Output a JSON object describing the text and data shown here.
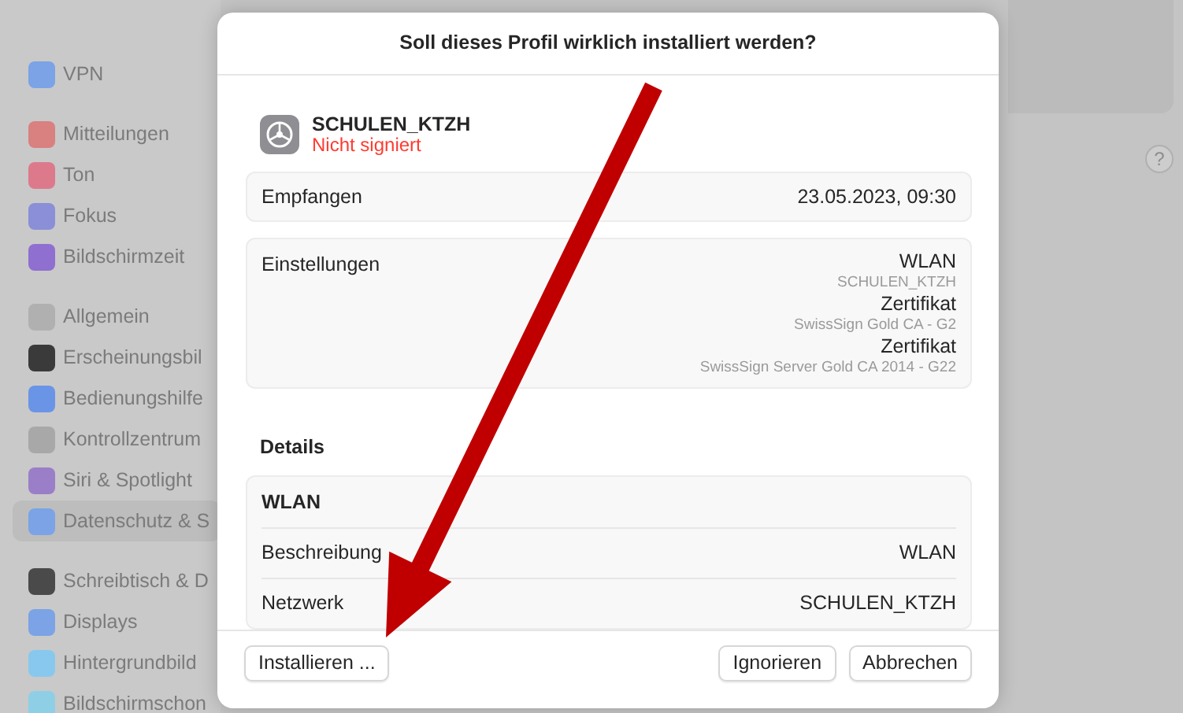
{
  "sidebar": {
    "groups": [
      {
        "items": [
          {
            "label": "VPN",
            "color": "#7ba3e6",
            "selected": false
          }
        ]
      },
      {
        "items": [
          {
            "label": "Mitteilungen",
            "color": "#d98080",
            "selected": false
          },
          {
            "label": "Ton",
            "color": "#dc7a8c",
            "selected": false
          },
          {
            "label": "Fokus",
            "color": "#8a8fd8",
            "selected": false
          },
          {
            "label": "Bildschirmzeit",
            "color": "#8f6fd0",
            "selected": false
          }
        ]
      },
      {
        "items": [
          {
            "label": "Allgemein",
            "color": "#b0b0b0",
            "selected": false
          },
          {
            "label": "Erscheinungsbil",
            "color": "#3a3a3a",
            "selected": false
          },
          {
            "label": "Bedienungshilfe",
            "color": "#6a95e6",
            "selected": false
          },
          {
            "label": "Kontrollzentrum",
            "color": "#a8a8a8",
            "selected": false
          },
          {
            "label": "Siri & Spotlight",
            "color": "#9a7fc8",
            "selected": false
          },
          {
            "label": "Datenschutz & S",
            "color": "#7ba3e6",
            "selected": true
          }
        ]
      },
      {
        "items": [
          {
            "label": "Schreibtisch & D",
            "color": "#4a4a4a",
            "selected": false
          },
          {
            "label": "Displays",
            "color": "#7ba3e6",
            "selected": false
          },
          {
            "label": "Hintergrundbild",
            "color": "#88c8ee",
            "selected": false
          },
          {
            "label": "Bildschirmschon",
            "color": "#8fcfe6",
            "selected": false
          }
        ]
      }
    ]
  },
  "help": {
    "label": "?"
  },
  "dialog": {
    "title": "Soll dieses Profil wirklich installiert werden?",
    "profile": {
      "name": "SCHULEN_KTZH",
      "status": "Nicht signiert"
    },
    "received": {
      "label": "Empfangen",
      "value": "23.05.2023, 09:30"
    },
    "settings": {
      "label": "Einstellungen",
      "entries": [
        {
          "title": "WLAN",
          "subtitle": "SCHULEN_KTZH"
        },
        {
          "title": "Zertifikat",
          "subtitle": "SwissSign Gold CA - G2"
        },
        {
          "title": "Zertifikat",
          "subtitle": "SwissSign Server Gold CA 2014 - G22"
        }
      ]
    },
    "details": {
      "heading": "Details",
      "group": "WLAN",
      "rows": [
        {
          "label": "Beschreibung",
          "value": "WLAN"
        },
        {
          "label": "Netzwerk",
          "value": "SCHULEN_KTZH"
        }
      ]
    },
    "buttons": {
      "left": [
        {
          "label": "Installieren ..."
        }
      ],
      "right": [
        {
          "label": "Ignorieren"
        },
        {
          "label": "Abbrechen"
        }
      ]
    }
  }
}
